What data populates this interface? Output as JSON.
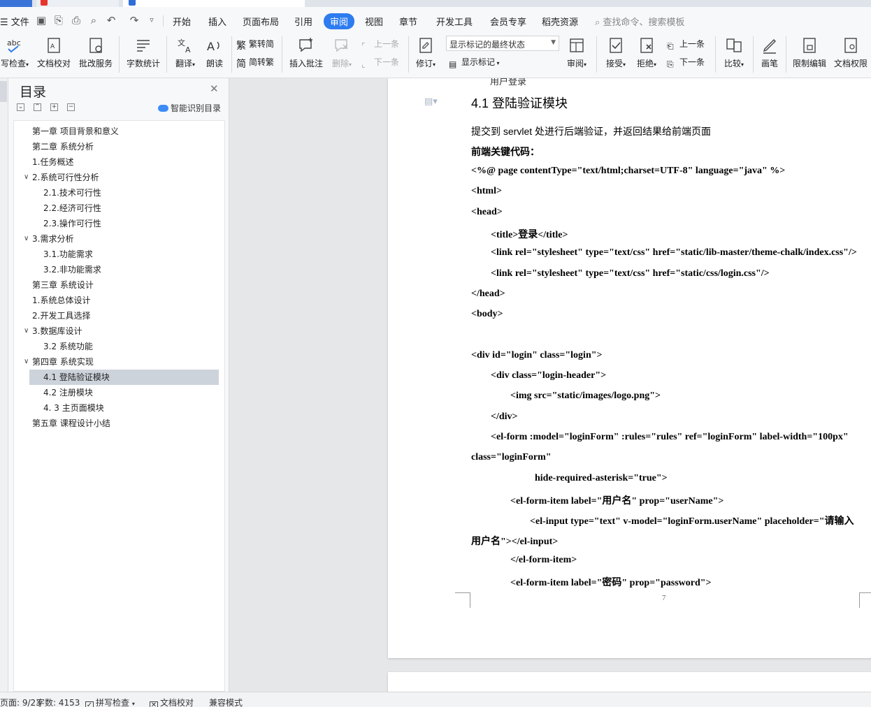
{
  "menu": {
    "file": "文件",
    "tabs": [
      "开始",
      "插入",
      "页面布局",
      "引用",
      "审阅",
      "视图",
      "章节",
      "开发工具",
      "会员专享",
      "稻壳资源"
    ],
    "active_tab": "审阅",
    "search_placeholder": "查找命令、搜索模板"
  },
  "ribbon": {
    "spell_check": "写检查",
    "doc_proof": "文档校对",
    "batch_service": "批改服务",
    "word_count": "字数统计",
    "translate": "翻译",
    "read_aloud": "朗读",
    "trad_to_simp": "繁转简",
    "simp_to_trad": "简转繁",
    "insert_comment": "插入批注",
    "delete": "删除",
    "prev_comment": "上一条",
    "next_comment": "下一条",
    "track_changes": "修订",
    "markup_mode": "显示标记的最终状态",
    "show_markup": "显示标记",
    "review": "审阅",
    "accept": "接受",
    "reject": "拒绝",
    "prev_change": "上一条",
    "next_change": "下一条",
    "compare": "比较",
    "ink": "画笔",
    "restrict_edit": "限制编辑",
    "doc_permission": "文档权限"
  },
  "nav": {
    "title": "目录",
    "smart_toc": "智能识别目录",
    "items": [
      {
        "label": "第一章  项目背景和意义",
        "level": 1,
        "arrow": ""
      },
      {
        "label": "第二章  系统分析",
        "level": 1,
        "arrow": ""
      },
      {
        "label": "1.任务概述",
        "level": 1,
        "arrow": ""
      },
      {
        "label": "2.系统可行性分析",
        "level": 1,
        "arrow": "expanded"
      },
      {
        "label": "2.1.技术可行性",
        "level": 2,
        "arrow": ""
      },
      {
        "label": "2.2.经济可行性",
        "level": 2,
        "arrow": ""
      },
      {
        "label": "2.3.操作可行性",
        "level": 2,
        "arrow": ""
      },
      {
        "label": "3.需求分析",
        "level": 1,
        "arrow": "expanded"
      },
      {
        "label": "3.1.功能需求",
        "level": 2,
        "arrow": ""
      },
      {
        "label": "3.2.非功能需求",
        "level": 2,
        "arrow": ""
      },
      {
        "label": "第三章  系统设计",
        "level": 1,
        "arrow": ""
      },
      {
        "label": "1.系统总体设计",
        "level": 1,
        "arrow": ""
      },
      {
        "label": "2.开发工具选择",
        "level": 1,
        "arrow": ""
      },
      {
        "label": "3.数据库设计",
        "level": 1,
        "arrow": "expanded"
      },
      {
        "label": "3.2  系统功能",
        "level": 2,
        "arrow": ""
      },
      {
        "label": "第四章  系统实现",
        "level": 1,
        "arrow": "expanded"
      },
      {
        "label": "4.1  登陆验证模块",
        "level": 2,
        "arrow": "",
        "selected": true
      },
      {
        "label": "4.2  注册模块",
        "level": 2,
        "arrow": ""
      },
      {
        "label": "4. 3  主页面模块",
        "level": 2,
        "arrow": ""
      },
      {
        "label": "第五章  课程设计小结",
        "level": 1,
        "arrow": ""
      }
    ]
  },
  "document": {
    "cut_line": "用户登录",
    "heading": "4.1  登陆验证模块",
    "intro": "提交到 servlet 处进行后端验证，并返回结果给前端页面",
    "code_title": "前端关键代码：",
    "lines": [
      {
        "text": "<%@ page contentType=\"text/html;charset=UTF-8\" language=\"java\" %>",
        "indent": 0
      },
      {
        "text": "<html>",
        "indent": 0
      },
      {
        "text": "<head>",
        "indent": 0
      },
      {
        "text": "<title>登录</title>",
        "indent": 1
      },
      {
        "text": "<link rel=\"stylesheet\"  type=\"text/css\"  href=\"static/lib-master/theme-chalk/index.css\"/>",
        "indent": 1
      },
      {
        "text": "<link rel=\"stylesheet\"  type=\"text/css\"  href=\"static/css/login.css\"/>",
        "indent": 1
      },
      {
        "text": "</head>",
        "indent": 0
      },
      {
        "text": "<body>",
        "indent": 0
      },
      {
        "text": "",
        "indent": 0
      },
      {
        "text": "<div id=\"login\"  class=\"login\">",
        "indent": 0
      },
      {
        "text": "<div class=\"login-header\">",
        "indent": 1
      },
      {
        "text": "<img src=\"static/images/logo.png\">",
        "indent": 2
      },
      {
        "text": "</div>",
        "indent": 1
      },
      {
        "text": "<el-form   :model=\"loginForm\"   :rules=\"rules\"   ref=\"loginForm\"   label-width=\"100px\"",
        "indent": 1
      },
      {
        "text": "class=\"loginForm\"",
        "indent": 0
      },
      {
        "text": "hide-required-asterisk=\"true\">",
        "indent": 3
      },
      {
        "text": "<el-form-item label=\"用户名\" prop=\"userName\">",
        "indent": 2
      },
      {
        "text": "<el-input  type=\"text\"  v-model=\"loginForm.userName\"  placeholder=\"请输入",
        "indent": 3
      },
      {
        "text": "用户名\"></el-input>",
        "indent": 0
      },
      {
        "text": "</el-form-item>",
        "indent": 2
      },
      {
        "text": "<el-form-item label=\"密码\" prop=\"password\">",
        "indent": 2
      }
    ],
    "page_number": "7"
  },
  "status": {
    "page": "页面: 9/23",
    "words": "字数: 4153",
    "spell_check": "拼写检查",
    "doc_proof": "文档校对",
    "compat_mode": "兼容模式"
  },
  "colors": {
    "accent": "#2d7cf0",
    "toc_selected": "#cdd3db"
  }
}
